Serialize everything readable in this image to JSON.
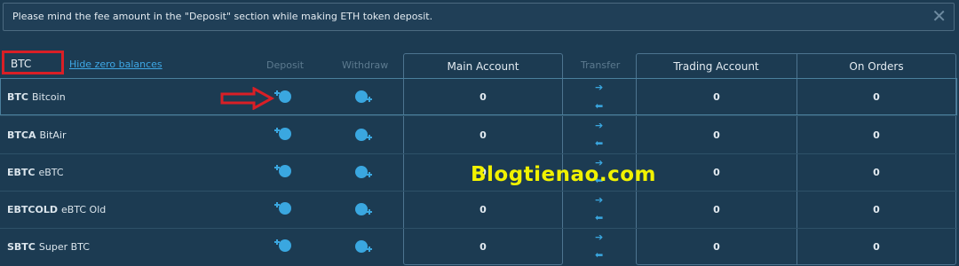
{
  "notice": {
    "text": "Please mind the fee amount in the \"Deposit\" section while making ETH token deposit.",
    "close_icon": "close-icon"
  },
  "filter": {
    "value": "BTC",
    "hide_zero_label": "Hide zero balances"
  },
  "columns": {
    "deposit": "Deposit",
    "withdraw": "Withdraw",
    "main_account": "Main Account",
    "transfer": "Transfer",
    "trading_account": "Trading Account",
    "on_orders": "On Orders"
  },
  "rows": [
    {
      "symbol": "BTC",
      "name": "Bitcoin",
      "main": "0",
      "trading": "0",
      "orders": "0",
      "selected": true
    },
    {
      "symbol": "BTCA",
      "name": "BitAir",
      "main": "0",
      "trading": "0",
      "orders": "0",
      "selected": false
    },
    {
      "symbol": "EBTC",
      "name": "eBTC",
      "main": "0",
      "trading": "0",
      "orders": "0",
      "selected": false
    },
    {
      "symbol": "EBTCOLD",
      "name": "eBTC Old",
      "main": "0",
      "trading": "0",
      "orders": "0",
      "selected": false
    },
    {
      "symbol": "SBTC",
      "name": "Super BTC",
      "main": "0",
      "trading": "0",
      "orders": "0",
      "selected": false
    }
  ],
  "icons": {
    "deposit": "deposit-icon",
    "withdraw": "withdraw-icon",
    "transfer_right": "arrow-right-icon",
    "transfer_left": "arrow-left-icon"
  },
  "colors": {
    "background": "#1c3b52",
    "accent": "#3aa7e0",
    "highlight": "#d91f26",
    "watermark": "#f1f200"
  },
  "watermark": "Blogtienao.com"
}
